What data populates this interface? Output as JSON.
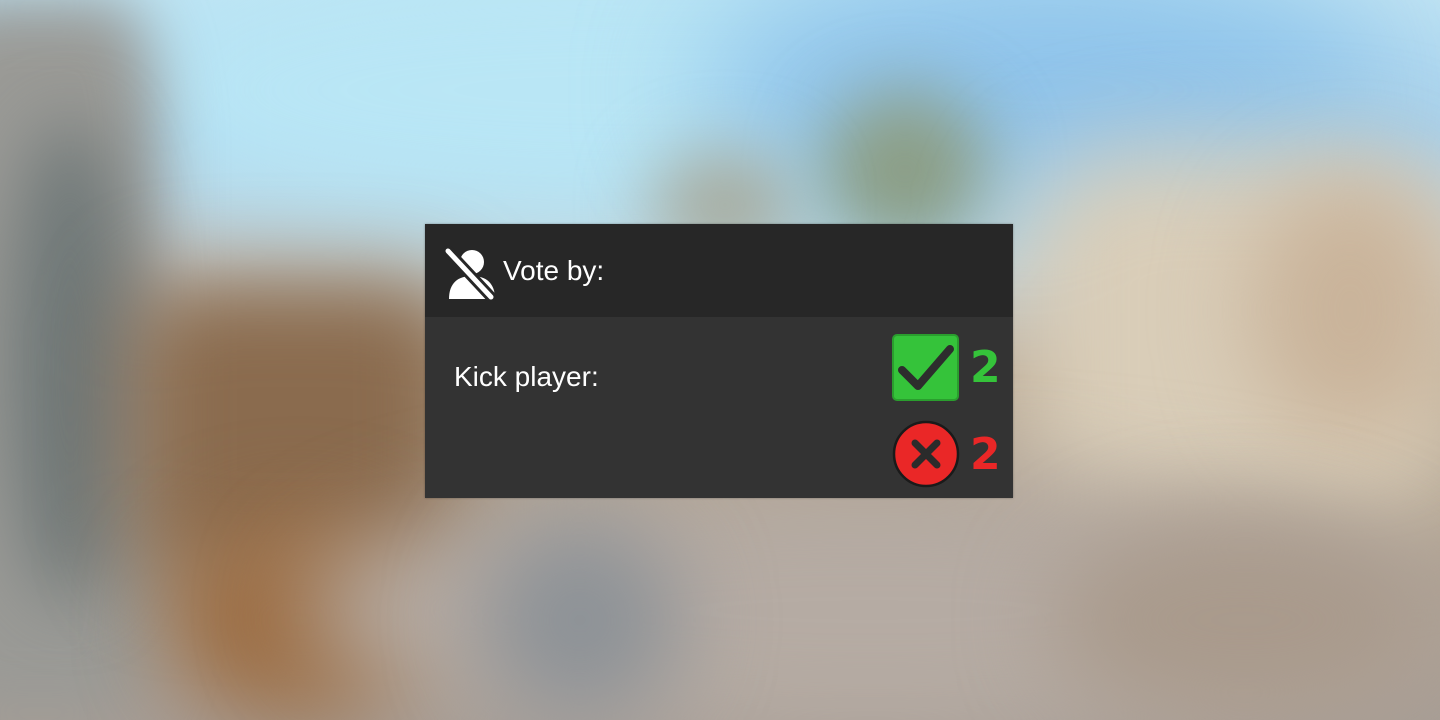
{
  "vote_panel": {
    "title": "Vote by:",
    "subject_label": "Kick player:",
    "header_icon": "kick-player-icon",
    "votes": {
      "yes": {
        "count": "2",
        "icon": "check-icon",
        "color": "#35c33a"
      },
      "no": {
        "count": "2",
        "icon": "cross-icon",
        "color": "#ea2727"
      }
    }
  }
}
